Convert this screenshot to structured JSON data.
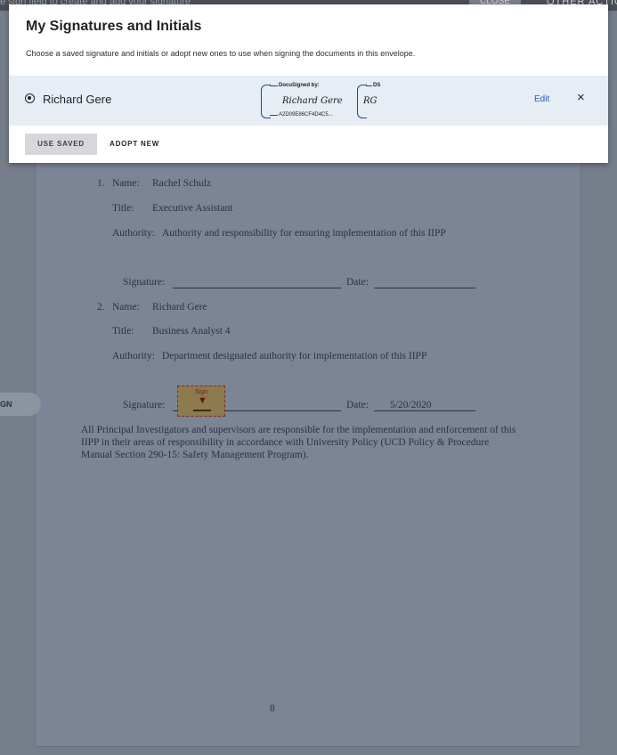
{
  "topbar": {
    "left_text": "e sign field to create and add your signature",
    "close_label": "CLOSE",
    "other_label": "OTHER ACTIO"
  },
  "dialog": {
    "title": "My Signatures and Initials",
    "subtitle": "Choose a saved signature and initials or adopt new ones to use when signing the documents in this envelope.",
    "signer_name": "Richard Gere",
    "signature": {
      "header": "DocuSigned by:",
      "script": "Richard Gere",
      "hash": "A2D09E86CF4D4C5..."
    },
    "initials": {
      "header": "DS",
      "script": "RG"
    },
    "edit_label": "Edit",
    "close_glyph": "×",
    "use_saved_label": "USE SAVED",
    "adopt_new_label": "ADOPT NEW"
  },
  "document": {
    "entries": [
      {
        "number": "1.",
        "name_label": "Name:",
        "name": "Rachel Schulz",
        "title_label": "Title:",
        "title": "Executive Assistant",
        "authority_label": "Authority:",
        "authority": "Authority and responsibility for ensuring implementation of this IIPP",
        "signature_label": "Signature:",
        "date_label": "Date:",
        "date": ""
      },
      {
        "number": "2.",
        "name_label": "Name:",
        "name": "Richard Gere",
        "title_label": "Title:",
        "title": "Business Analyst 4",
        "authority_label": "Authority:",
        "authority": "Department designated authority for implementation of this IIPP",
        "signature_label": "Signature:",
        "date_label": "Date:",
        "date": "5/20/2020"
      }
    ],
    "paragraph_lines": [
      "All Principal Investigators and supervisors are responsible for the implementation and enforcement of this",
      "IIPP in their areas of responsibility in accordance with University Policy (UCD Policy & Procedure",
      "Manual Section 290-15: Safety Management Program)."
    ],
    "page_number": "8"
  },
  "sign_tab_label": "GN",
  "sign_tag_label": "Sign"
}
